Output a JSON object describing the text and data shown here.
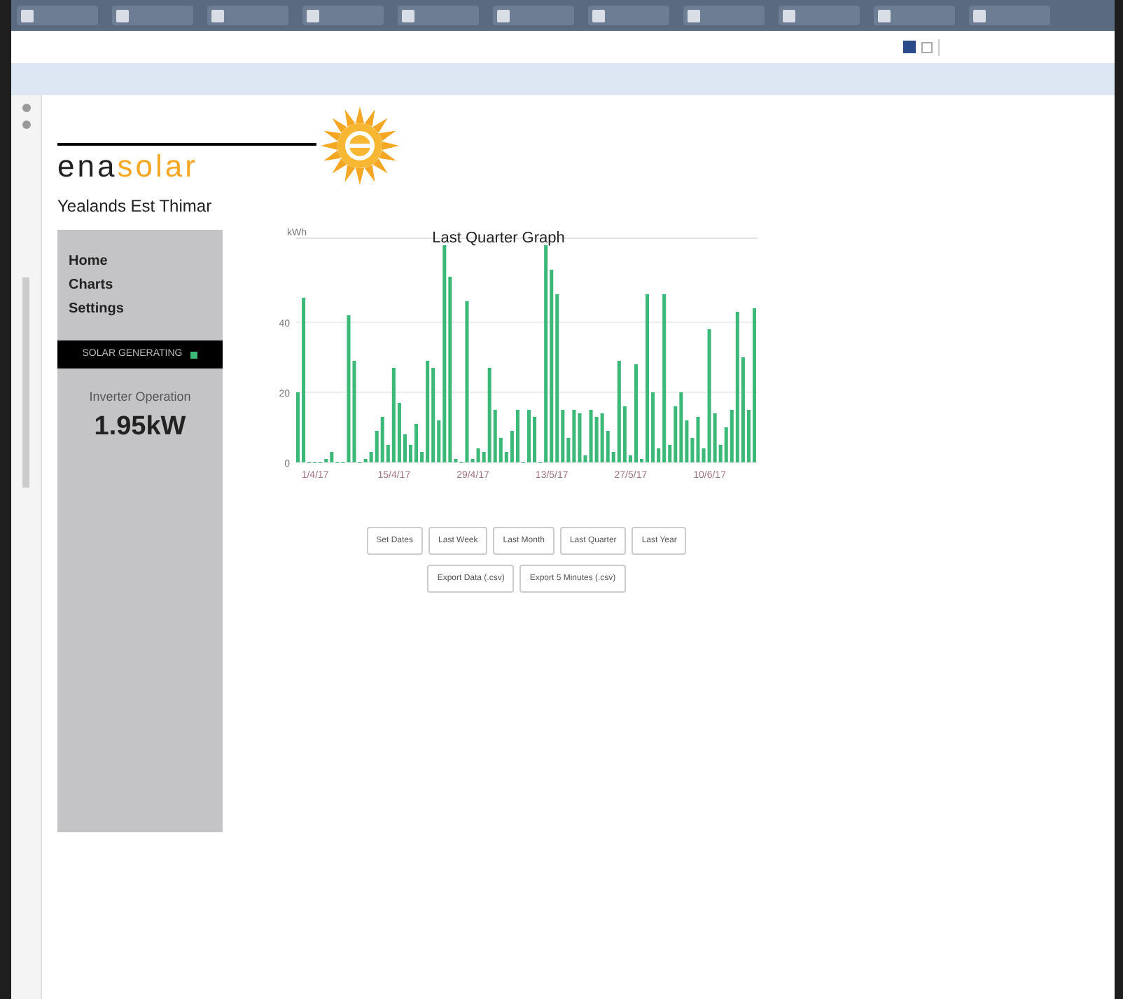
{
  "brand": {
    "logo_dark": "ena",
    "logo_light": "solar",
    "site": "Yealands Est Thimar"
  },
  "nav": [
    "Home",
    "Charts",
    "Settings"
  ],
  "status": {
    "label": "SOLAR GENERATING",
    "on": true
  },
  "reading": {
    "label": "Inverter Operation",
    "value": "1.95kW"
  },
  "chart_data": {
    "type": "bar",
    "title": "Last Quarter Graph",
    "ylabel": "kWh",
    "ylim": [
      0,
      64
    ],
    "yticks": [
      0,
      20,
      40
    ],
    "categories": [
      null,
      null,
      null,
      "1/4/17",
      null,
      null,
      null,
      null,
      null,
      null,
      null,
      null,
      null,
      null,
      null,
      null,
      null,
      "15/4/17",
      null,
      null,
      null,
      null,
      null,
      null,
      null,
      null,
      null,
      null,
      null,
      null,
      null,
      "29/4/17",
      null,
      null,
      null,
      null,
      null,
      null,
      null,
      null,
      null,
      null,
      null,
      null,
      null,
      "13/5/17",
      null,
      null,
      null,
      null,
      null,
      null,
      null,
      null,
      null,
      null,
      null,
      null,
      null,
      "27/5/17",
      null,
      null,
      null,
      null,
      null,
      null,
      null,
      null,
      null,
      null,
      null,
      null,
      null,
      "10/6/17",
      null,
      null,
      null,
      null,
      null,
      null,
      null,
      null
    ],
    "series": [
      {
        "color": "#3cb878",
        "values": [
          20,
          47,
          0,
          0,
          0,
          1,
          3,
          0,
          0,
          42,
          29,
          0,
          1,
          3,
          9,
          13,
          5,
          27,
          17,
          8,
          5,
          11,
          3,
          29,
          27,
          12,
          62,
          53,
          1,
          0,
          46,
          1,
          4,
          3,
          27,
          15,
          7,
          3,
          9,
          15,
          0,
          15,
          13,
          0,
          62,
          55,
          48,
          15,
          7,
          15,
          14,
          2,
          15,
          13,
          14,
          9,
          3,
          29,
          16,
          2,
          28,
          1,
          48,
          20,
          4,
          48,
          5,
          16,
          20,
          12,
          7,
          13,
          4,
          38,
          14,
          5,
          10,
          15,
          43,
          30,
          15,
          44
        ]
      }
    ]
  },
  "range_buttons": [
    "Set Dates",
    "Last Week",
    "Last Month",
    "Last Quarter",
    "Last Year"
  ],
  "export_buttons": [
    "Export Data (.csv)",
    "Export 5 Minutes (.csv)"
  ]
}
